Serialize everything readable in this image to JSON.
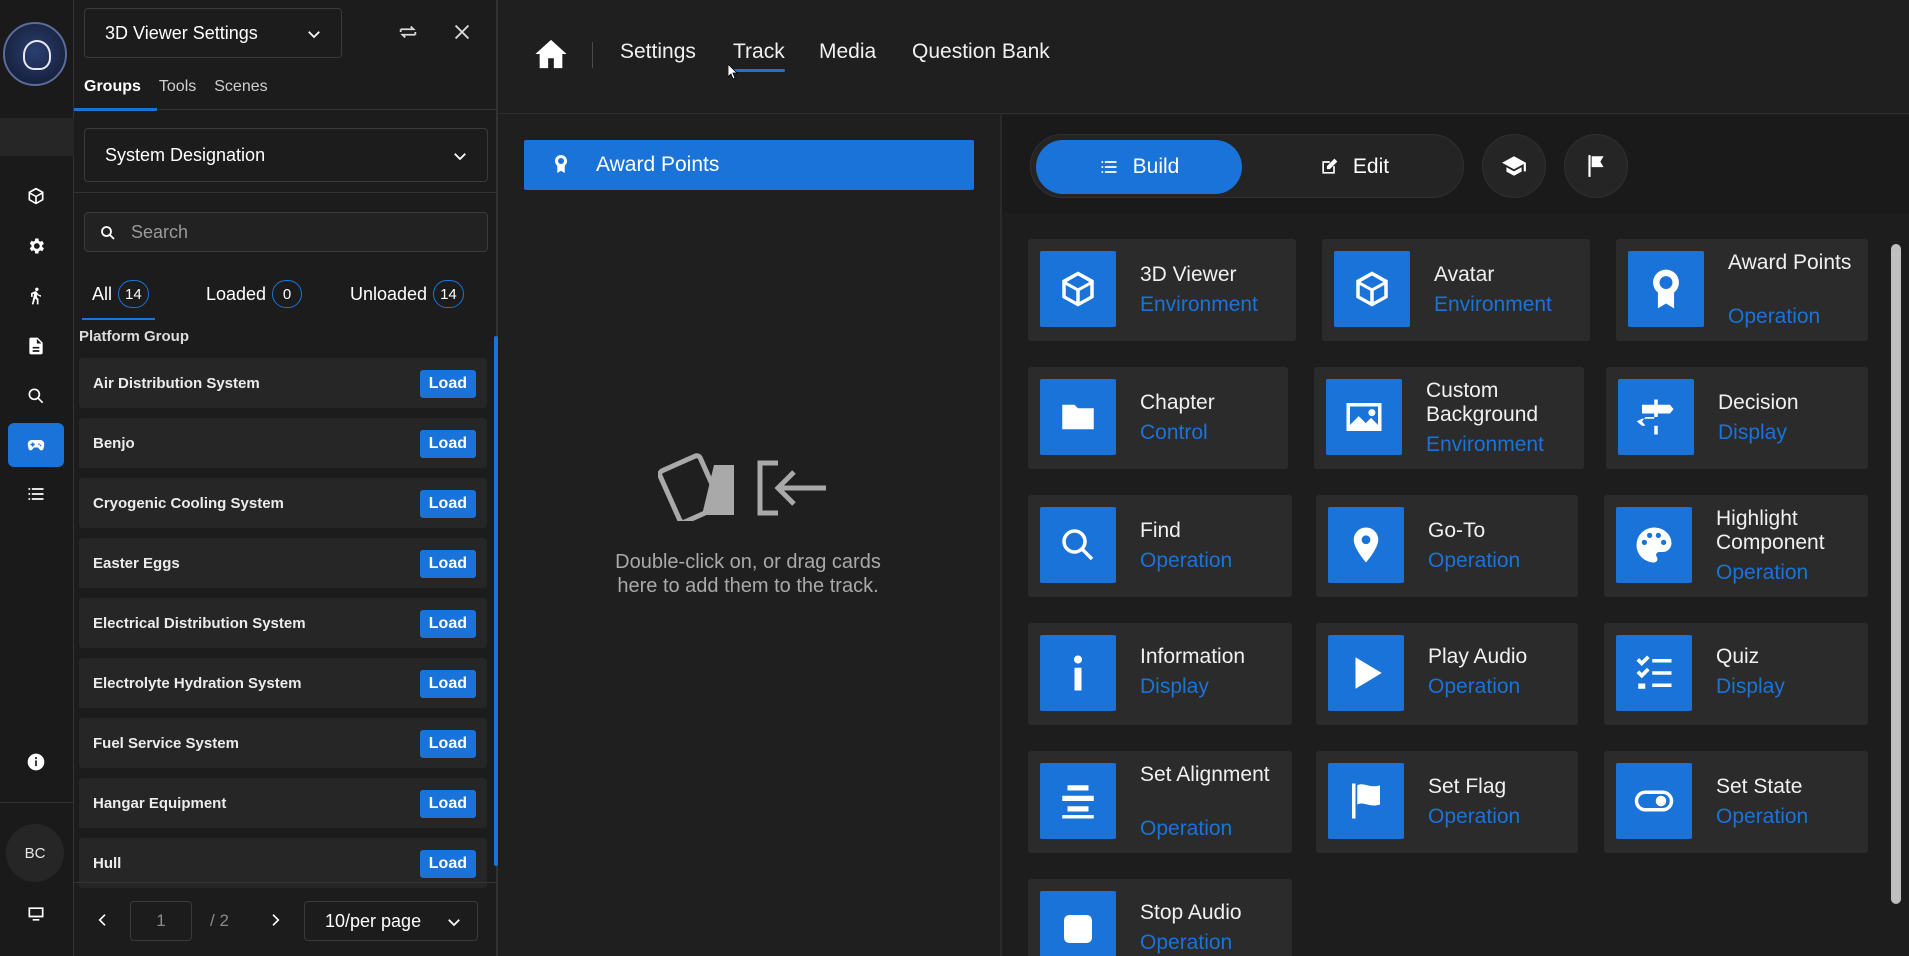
{
  "rail": {
    "avatar_initials": "BC",
    "items": [
      "cube-icon",
      "gear-icon",
      "walk-icon",
      "document-icon",
      "search-icon",
      "gamepad-icon",
      "list-icon",
      "info-icon",
      "monitor-icon"
    ]
  },
  "panel": {
    "viewer_select": "3D Viewer Settings",
    "tabs": [
      "Groups",
      "Tools",
      "Scenes"
    ],
    "filter_select": "System Designation",
    "search_placeholder": "Search",
    "counts": {
      "all_label": "All",
      "all": "14",
      "loaded_label": "Loaded",
      "loaded": "0",
      "unloaded_label": "Unloaded",
      "unloaded": "14"
    },
    "group_title": "Platform Group",
    "load_label": "Load",
    "items": [
      "Air Distribution System",
      "Benjo",
      "Cryogenic Cooling System",
      "Easter Eggs",
      "Electrical Distribution System",
      "Electrolyte Hydration System",
      "Fuel Service System",
      "Hangar Equipment",
      "Hull"
    ],
    "pager": {
      "page": "1",
      "total": "/ 2",
      "per_page": "10/per page"
    }
  },
  "topbar": {
    "nav": [
      "Settings",
      "Track",
      "Media",
      "Question Bank"
    ],
    "active": "Track"
  },
  "track": {
    "award_label": "Award Points",
    "hint": "Double-click on, or drag cards here to add them to the track."
  },
  "palette": {
    "build_label": "Build",
    "edit_label": "Edit",
    "cards": [
      {
        "title": "3D Viewer",
        "category": "Environment",
        "icon": "cube-icon"
      },
      {
        "title": "Avatar",
        "category": "Environment",
        "icon": "cube-icon"
      },
      {
        "title": "Award Points",
        "category": "Operation",
        "icon": "award-icon"
      },
      {
        "title": "Chapter",
        "category": "Control",
        "icon": "folder-icon"
      },
      {
        "title": "Custom Background",
        "category": "Environment",
        "icon": "image-icon"
      },
      {
        "title": "Decision",
        "category": "Display",
        "icon": "signpost-icon"
      },
      {
        "title": "Find",
        "category": "Operation",
        "icon": "search-icon"
      },
      {
        "title": "Go-To",
        "category": "Operation",
        "icon": "location-pin-icon"
      },
      {
        "title": "Highlight Component",
        "category": "Operation",
        "icon": "palette-icon"
      },
      {
        "title": "Information",
        "category": "Display",
        "icon": "info-icon"
      },
      {
        "title": "Play Audio",
        "category": "Operation",
        "icon": "play-icon"
      },
      {
        "title": "Quiz",
        "category": "Display",
        "icon": "checklist-icon"
      },
      {
        "title": "Set Alignment",
        "category": "Operation",
        "icon": "align-center-icon"
      },
      {
        "title": "Set Flag",
        "category": "Operation",
        "icon": "flag-icon"
      },
      {
        "title": "Set State",
        "category": "Operation",
        "icon": "toggle-icon"
      },
      {
        "title": "Stop Audio",
        "category": "Operation",
        "icon": "stop-icon"
      }
    ]
  }
}
